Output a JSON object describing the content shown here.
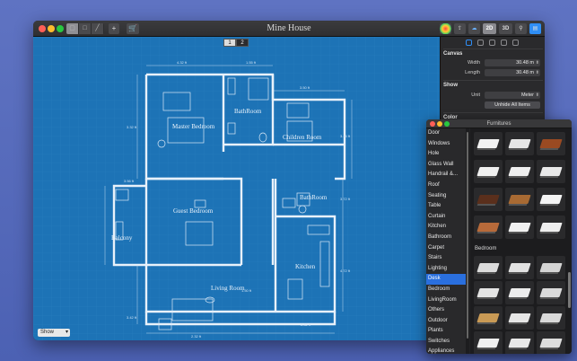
{
  "window": {
    "title": "Mine House"
  },
  "toolbar": {
    "add_label": "+",
    "cart_label": "🛒",
    "mode_2d": "2D",
    "mode_3d": "3D"
  },
  "canvas": {
    "floors": [
      "1",
      "2"
    ],
    "show_select": "Show",
    "rooms": {
      "master_bedroom": "Master Bedroom",
      "bathroom_top": "BathRoom",
      "children_room": "Children Room",
      "guest_bedroom": "Guest Bedroom",
      "bathroom_right": "BathRoom",
      "balcony": "Balcony",
      "kitchen": "Kitchen",
      "living_room": "Living Room"
    },
    "dimensions": [
      "4.32 ft",
      "1.55 ft",
      "3.50 ft",
      "3.32 ft",
      "3.44 ft",
      "3.56 ft",
      "3.72 ft",
      "4.72 ft",
      "3.42 ft",
      "1.50 ft",
      "2.32 ft",
      "2.32 ft"
    ]
  },
  "inspector": {
    "canvas_title": "Canvas",
    "width_label": "Width",
    "width_value": "30.48 m",
    "length_label": "Length",
    "length_value": "30.48 m",
    "show_title": "Show",
    "unit_label": "Unit",
    "unit_value": "Meter",
    "unhide_label": "Unhide All Items",
    "color_title": "Color"
  },
  "furnitures": {
    "title": "Furnitures",
    "categories": [
      "Door",
      "Windows",
      "Hole",
      "Glass Wall",
      "Handrail &...",
      "Roof",
      "Seating",
      "Table",
      "Curtain",
      "Kitchen",
      "Bathroom",
      "Carpet",
      "Stairs",
      "Lighting",
      "Desk",
      "Bedroom",
      "LivingRoom",
      "Others",
      "Outdoor",
      "Plants",
      "Switches",
      "Appliances"
    ],
    "selected": "Desk",
    "section_bedroom": "Bedroom"
  },
  "colors": {
    "canvas_bg": "#1d73b6",
    "wall": "#e8f1fa",
    "selected": "#2a6fde"
  }
}
